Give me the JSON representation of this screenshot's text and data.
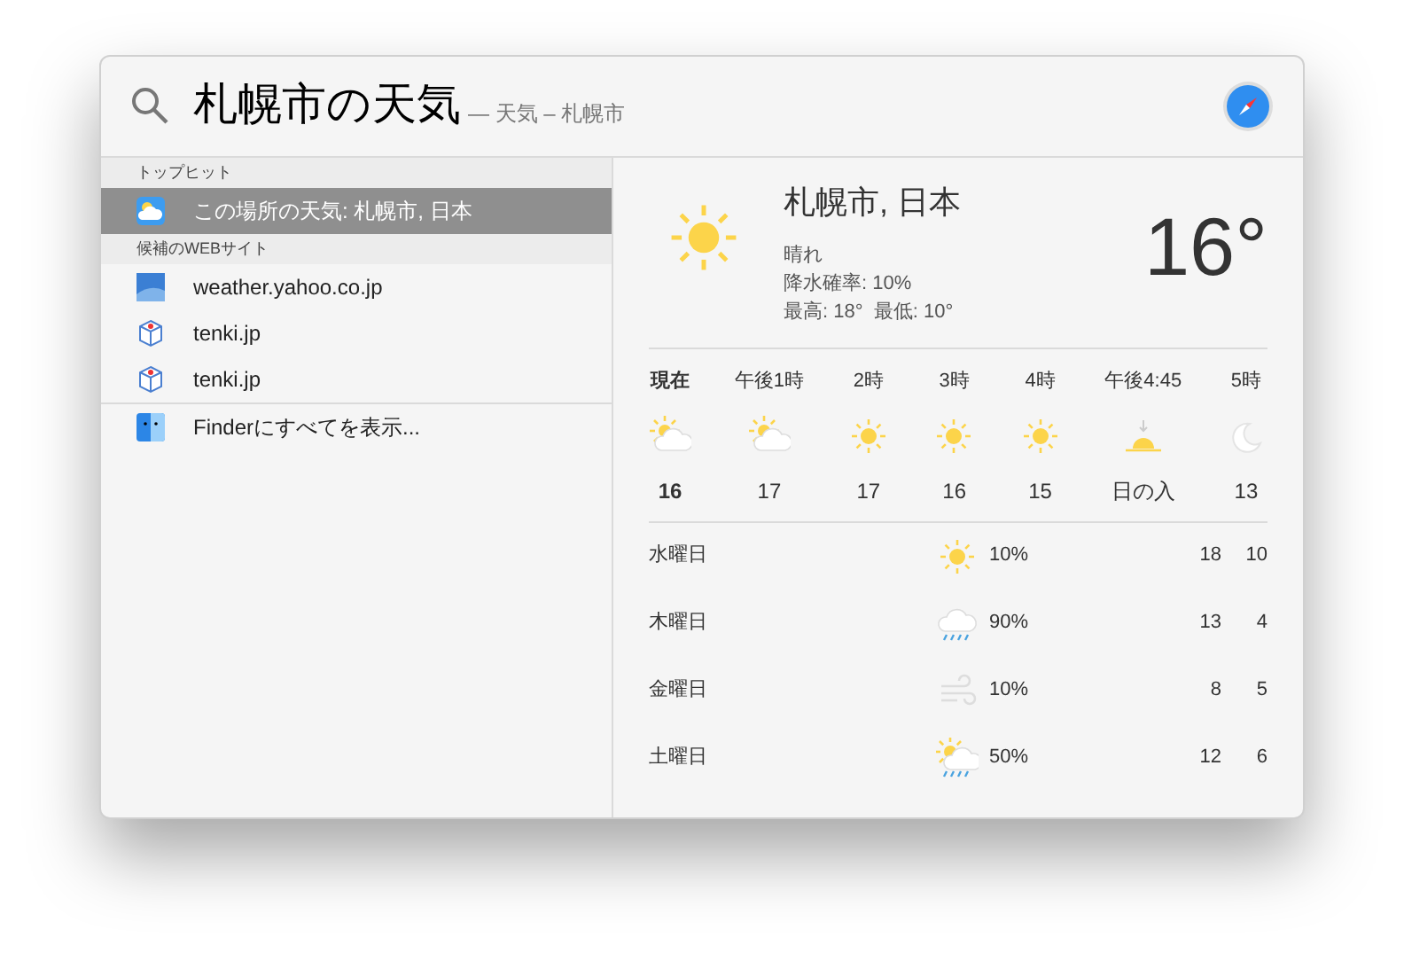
{
  "search": {
    "query": "札幌市の天気",
    "suggestion": "— 天気 – 札幌市"
  },
  "sections": [
    {
      "title": "トップヒット",
      "items": [
        {
          "label": "この場所の天気: 札幌市, 日本",
          "kind": "weather",
          "selected": true
        }
      ]
    },
    {
      "title": "候補のWEBサイト",
      "items": [
        {
          "label": "weather.yahoo.co.jp",
          "kind": "sky",
          "selected": false
        },
        {
          "label": "tenki.jp",
          "kind": "cube",
          "selected": false
        },
        {
          "label": "tenki.jp",
          "kind": "cube",
          "selected": false
        }
      ]
    }
  ],
  "finder": {
    "label": "Finderにすべてを表示..."
  },
  "weather": {
    "city": "札幌市, 日本",
    "condition": "晴れ",
    "precip": "降水確率: 10%",
    "high_low": "最高: 18°  最低: 10°",
    "temp": "16°",
    "hourly": [
      {
        "time": "現在",
        "kind": "partly",
        "temp": "16",
        "selected": true
      },
      {
        "time": "午後1時",
        "kind": "partly",
        "temp": "17",
        "selected": false
      },
      {
        "time": "2時",
        "kind": "sun",
        "temp": "17",
        "selected": false
      },
      {
        "time": "3時",
        "kind": "sun",
        "temp": "16",
        "selected": false
      },
      {
        "time": "4時",
        "kind": "sun",
        "temp": "15",
        "selected": false
      },
      {
        "time": "午後4:45",
        "kind": "sunset",
        "temp": "日の入",
        "selected": false
      },
      {
        "time": "5時",
        "kind": "moon",
        "temp": "13",
        "selected": false
      }
    ],
    "daily": [
      {
        "day": "水曜日",
        "kind": "sun",
        "precip": "10%",
        "high": "18",
        "low": "10"
      },
      {
        "day": "木曜日",
        "kind": "rain",
        "precip": "90%",
        "high": "13",
        "low": "4"
      },
      {
        "day": "金曜日",
        "kind": "wind",
        "precip": "10%",
        "high": "8",
        "low": "5"
      },
      {
        "day": "土曜日",
        "kind": "partlyrain",
        "precip": "50%",
        "high": "12",
        "low": "6"
      }
    ]
  }
}
